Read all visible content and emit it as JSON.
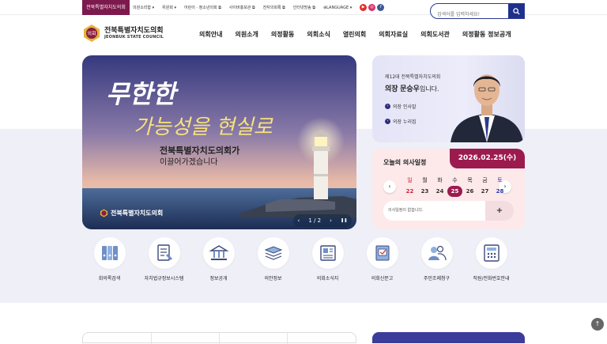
{
  "topbar": {
    "home": "전북특별자치도의회",
    "links": [
      "의원소리함",
      "위원회",
      "어린이 · 청소년의회",
      "사이버홍보관",
      "전자의회록",
      "인터넷방송"
    ],
    "language": "LANGUAGE",
    "social": [
      "youtube",
      "instagram",
      "facebook"
    ]
  },
  "search": {
    "placeholder": "검색어를 입력하세요!"
  },
  "logo": {
    "name": "전북특별자치도의회",
    "english": "JEONBUK STATE COUNCIL",
    "seal_text": "의회"
  },
  "gnb": [
    "의회안내",
    "의원소개",
    "의정활동",
    "의회소식",
    "열린의회",
    "의회자료실",
    "의회도서관",
    "의정활동 정보공개"
  ],
  "hero": {
    "headline_1": "무한한",
    "headline_2": "가능성을 현실로",
    "line1": "전북특별자치도의회가",
    "line2": "이끌어가겠습니다",
    "brand": "전북특별자치도의회",
    "current": "1",
    "total": "2",
    "prev": "‹",
    "next": "›",
    "pause": "❚❚"
  },
  "chair": {
    "line1": "제12대 전북특별자치도의회",
    "role": "의장",
    "name": "문승우",
    "suffix": "입니다.",
    "menu": [
      "의장 인사말",
      "의장 누리집"
    ]
  },
  "schedule": {
    "title": "오늘의 의사일정",
    "date": "2026.02.25(수)",
    "days": [
      "일",
      "월",
      "화",
      "수",
      "목",
      "금",
      "토"
    ],
    "nums": [
      "22",
      "23",
      "24",
      "25",
      "26",
      "27",
      "28"
    ],
    "selected_index": 3,
    "empty": "의사일정이 없습니다.",
    "plus": "+",
    "colors": {
      "sunday": "#c8283a",
      "saturday": "#2a3fb0",
      "accent": "#9b1b4f"
    }
  },
  "quick": [
    {
      "label": "회의록검색",
      "icon": "binders-icon"
    },
    {
      "label": "자치법규정보시스템",
      "icon": "law-document-icon"
    },
    {
      "label": "정보공개",
      "icon": "building-icon"
    },
    {
      "label": "의안정보",
      "icon": "document-stack-icon"
    },
    {
      "label": "의회소식지",
      "icon": "newsletter-icon"
    },
    {
      "label": "의회신문고",
      "icon": "petition-icon"
    },
    {
      "label": "주민조례청구",
      "icon": "residents-icon"
    },
    {
      "label": "직원/전화번호안내",
      "icon": "phone-directory-icon"
    }
  ],
  "colors": {
    "primary": "#1f2f8c",
    "accent": "#7d1a4d",
    "band": "#efeff7"
  }
}
